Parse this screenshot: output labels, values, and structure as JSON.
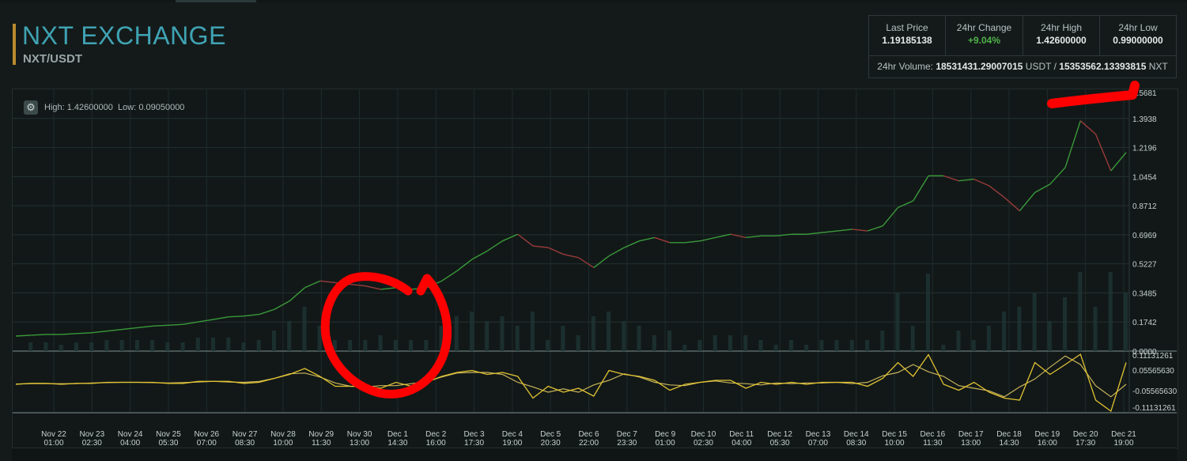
{
  "header": {
    "title": "NXT EXCHANGE",
    "pair": "NXT/USDT"
  },
  "stats": {
    "last_price_label": "Last Price",
    "last_price": "1.19185138",
    "change_label": "24hr Change",
    "change": "+9.04%",
    "high_label": "24hr High",
    "high": "1.42600000",
    "low_label": "24hr Low",
    "low": "0.99000000",
    "volume_label": "24hr Volume:",
    "volume_usdt": "18531431.29007015",
    "volume_usdt_unit": "USDT /",
    "volume_nxt": "15353562.13393815",
    "volume_nxt_unit": "NXT"
  },
  "chart_info": {
    "high_label": "High:",
    "high": "1.42600000",
    "low_label": "Low:",
    "low": "0.09050000"
  },
  "colors": {
    "price_up": "#3a9a3a",
    "price_down": "#9a3a3a",
    "indicator_fast": "#e0c232",
    "indicator_slow": "#c8b45a",
    "annotation": "#ff0000",
    "title": "#3fa3b3"
  },
  "chart_data": {
    "type": "line",
    "price_axis_labels": [
      "1.3938",
      "1.2196",
      "1.0454",
      "0.8712",
      "0.6969",
      "0.5227",
      "0.3485",
      "0.1742",
      "0.0000"
    ],
    "price_axis_values": [
      1.3938,
      1.2196,
      1.0454,
      0.8712,
      0.6969,
      0.5227,
      0.3485,
      0.1742,
      0.0
    ],
    "top_partial_label": "1.5681",
    "indicator_axis_labels": [
      "0.11131261",
      "0.05565630",
      "-0.05565630",
      "-0.11131261"
    ],
    "indicator_axis_values": [
      0.11131261,
      0.0556563,
      -0.0556563,
      -0.11131261
    ],
    "ylim": [
      0.0,
      1.5681
    ],
    "x_ticks": [
      [
        "Nov 22",
        "01:00"
      ],
      [
        "Nov 23",
        "02:30"
      ],
      [
        "Nov 24",
        "04:00"
      ],
      [
        "Nov 25",
        "05:30"
      ],
      [
        "Nov 26",
        "07:00"
      ],
      [
        "Nov 27",
        "08:30"
      ],
      [
        "Nov 28",
        "10:00"
      ],
      [
        "Nov 29",
        "11:30"
      ],
      [
        "Nov 30",
        "13:00"
      ],
      [
        "Dec 1",
        "14:30"
      ],
      [
        "Dec 2",
        "16:00"
      ],
      [
        "Dec 3",
        "17:30"
      ],
      [
        "Dec 4",
        "19:00"
      ],
      [
        "Dec 5",
        "20:30"
      ],
      [
        "Dec 6",
        "22:00"
      ],
      [
        "Dec 7",
        "23:30"
      ],
      [
        "Dec 9",
        "01:00"
      ],
      [
        "Dec 10",
        "02:30"
      ],
      [
        "Dec 11",
        "04:00"
      ],
      [
        "Dec 12",
        "05:30"
      ],
      [
        "Dec 13",
        "07:00"
      ],
      [
        "Dec 14",
        "08:30"
      ],
      [
        "Dec 15",
        "10:00"
      ],
      [
        "Dec 16",
        "11:30"
      ],
      [
        "Dec 17",
        "13:00"
      ],
      [
        "Dec 18",
        "14:30"
      ],
      [
        "Dec 19",
        "16:00"
      ],
      [
        "Dec 20",
        "17:30"
      ],
      [
        "Dec 21",
        "19:00"
      ]
    ],
    "price_series": [
      0.09,
      0.095,
      0.1,
      0.1,
      0.105,
      0.11,
      0.12,
      0.13,
      0.14,
      0.15,
      0.155,
      0.16,
      0.175,
      0.19,
      0.205,
      0.21,
      0.22,
      0.25,
      0.3,
      0.38,
      0.42,
      0.41,
      0.4,
      0.39,
      0.37,
      0.38,
      0.37,
      0.38,
      0.42,
      0.48,
      0.55,
      0.6,
      0.66,
      0.7,
      0.63,
      0.62,
      0.58,
      0.56,
      0.5,
      0.57,
      0.62,
      0.66,
      0.68,
      0.65,
      0.65,
      0.66,
      0.68,
      0.7,
      0.68,
      0.69,
      0.69,
      0.7,
      0.7,
      0.71,
      0.72,
      0.73,
      0.72,
      0.75,
      0.86,
      0.9,
      1.05,
      1.05,
      1.02,
      1.03,
      0.99,
      0.92,
      0.84,
      0.95,
      1.0,
      1.1,
      1.38,
      1.3,
      1.08,
      1.19
    ],
    "grid": true
  }
}
